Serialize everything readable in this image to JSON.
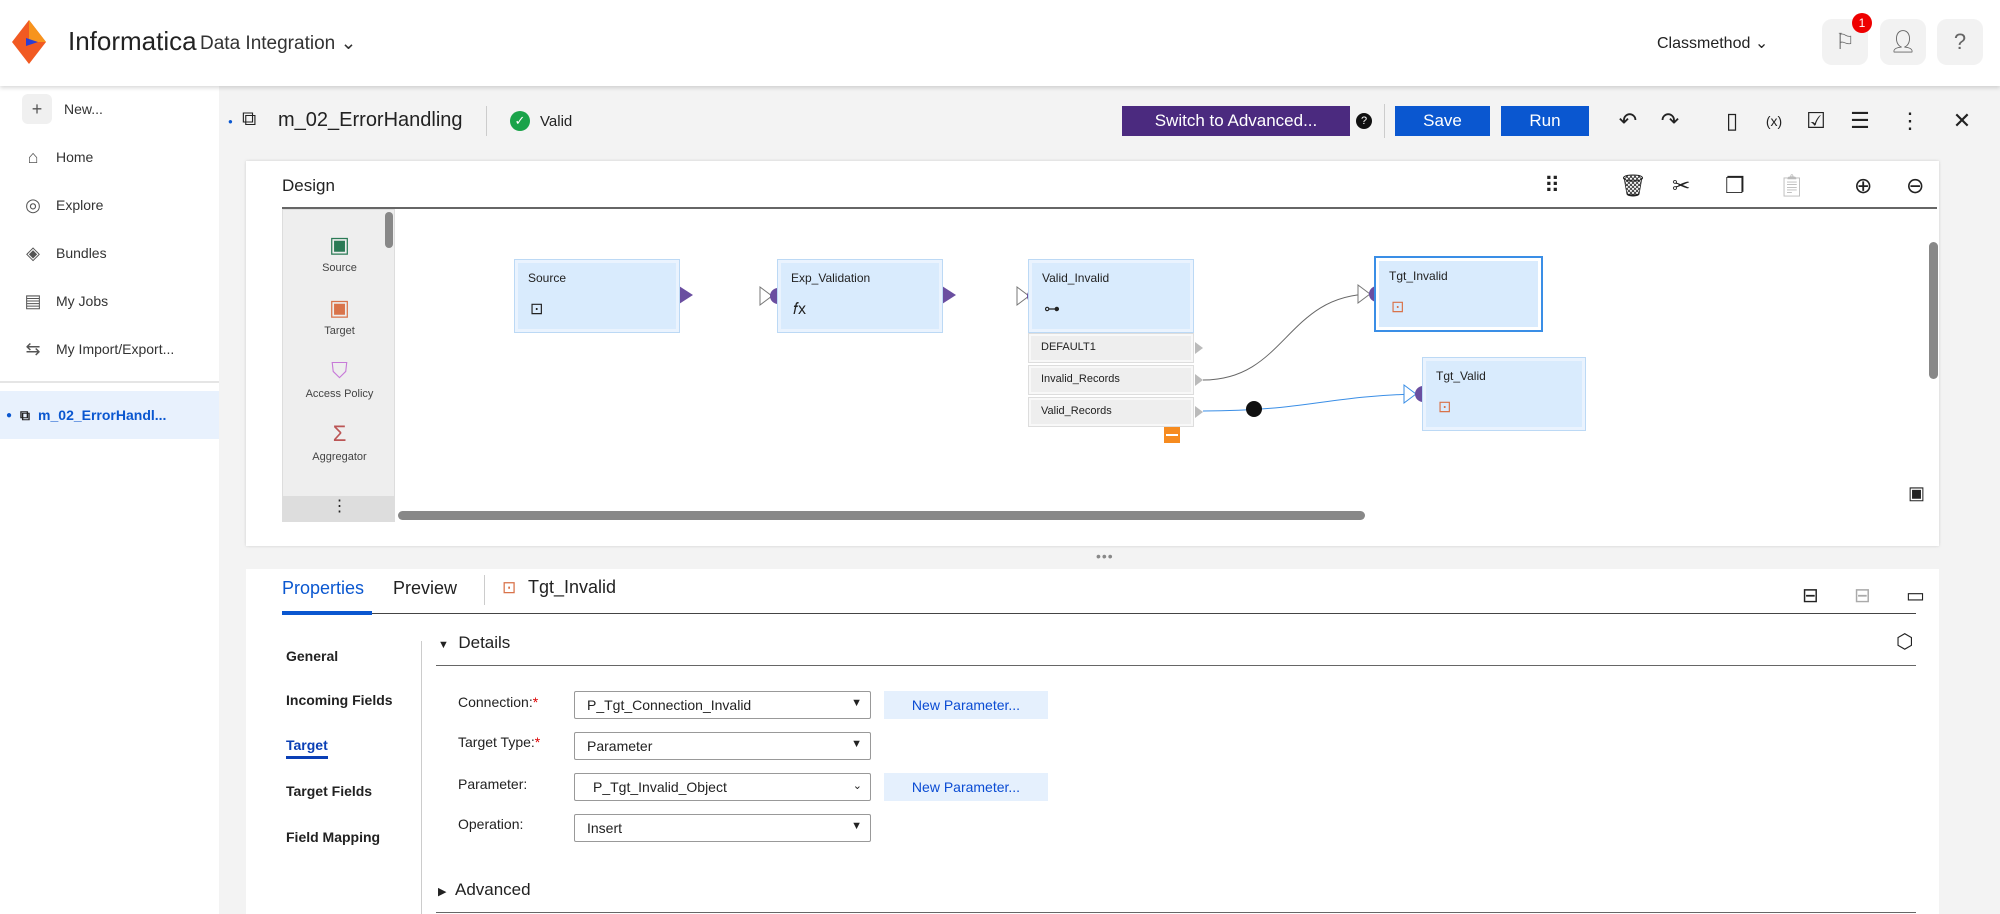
{
  "header": {
    "brand": "Informatica",
    "product": "Data Integration",
    "org": "Classmethod",
    "notification_count": "1"
  },
  "sidebar": {
    "items": [
      {
        "label": "New...",
        "icon": "plus-icon"
      },
      {
        "label": "Home",
        "icon": "home-icon"
      },
      {
        "label": "Explore",
        "icon": "compass-icon"
      },
      {
        "label": "Bundles",
        "icon": "layers-icon"
      },
      {
        "label": "My Jobs",
        "icon": "jobs-icon"
      },
      {
        "label": "My Import/Export...",
        "icon": "import-export-icon"
      }
    ],
    "open_tab": "m_02_ErrorHandl..."
  },
  "toolbar": {
    "mapping_name": "m_02_ErrorHandling",
    "status": "Valid",
    "switch_label": "Switch to Advanced...",
    "save_label": "Save",
    "run_label": "Run"
  },
  "design": {
    "title": "Design",
    "palette": [
      "Source",
      "Target",
      "Access Policy",
      "Aggregator"
    ],
    "nodes": {
      "source": "Source",
      "exp": "Exp_Validation",
      "router": "Valid_Invalid",
      "tgt_invalid": "Tgt_Invalid",
      "tgt_valid": "Tgt_Valid"
    },
    "groups": [
      "DEFAULT1",
      "Invalid_Records",
      "Valid_Records"
    ]
  },
  "properties": {
    "tabs": [
      "Properties",
      "Preview"
    ],
    "selected_object": "Tgt_Invalid",
    "nav": [
      "General",
      "Incoming Fields",
      "Target",
      "Target Fields",
      "Field Mapping"
    ],
    "active_nav": "Target",
    "details_label": "Details",
    "advanced_label": "Advanced",
    "fields": [
      {
        "label": "Connection:",
        "required": true,
        "value": "P_Tgt_Connection_Invalid"
      },
      {
        "label": "Target Type:",
        "required": true,
        "value": "Parameter"
      },
      {
        "label": "Parameter:",
        "required": false,
        "value": "P_Tgt_Invalid_Object"
      },
      {
        "label": "Operation:",
        "required": false,
        "value": "Insert"
      }
    ],
    "new_param_label": "New Parameter..."
  },
  "colors": {
    "accent": "#0a57d0",
    "switch": "#4b2a7f",
    "node": "#d9ebfd",
    "port": "#6a4ea0"
  }
}
